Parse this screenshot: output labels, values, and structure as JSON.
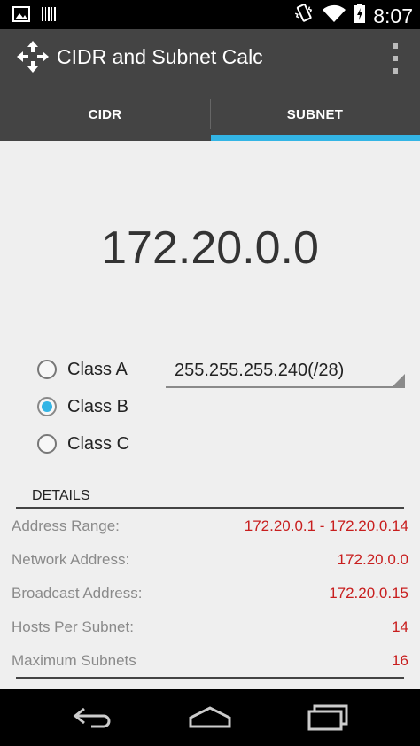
{
  "status_bar": {
    "time": "8:07",
    "icons": [
      "image-icon",
      "barcode-icon",
      "vibrate-icon",
      "wifi-icon",
      "battery-icon"
    ]
  },
  "action_bar": {
    "title": "CIDR and Subnet Calc",
    "app_icon": "move-arrows-icon",
    "overflow_icon": "overflow-menu-icon"
  },
  "tabs": [
    {
      "label": "CIDR",
      "selected": false
    },
    {
      "label": "SUBNET",
      "selected": true
    }
  ],
  "ip_address": "172.20.0.0",
  "ip_classes": [
    {
      "label": "Class A",
      "checked": false
    },
    {
      "label": "Class B",
      "checked": true
    },
    {
      "label": "Class C",
      "checked": false
    }
  ],
  "subnet_mask": {
    "selected": "255.255.255.240(/28)"
  },
  "details": {
    "header": "DETAILS",
    "rows": [
      {
        "label": "Address Range:",
        "value": "172.20.0.1 - 172.20.0.14"
      },
      {
        "label": "Network Address:",
        "value": "172.20.0.0"
      },
      {
        "label": "Broadcast Address:",
        "value": "172.20.0.15"
      },
      {
        "label": "Hosts Per Subnet:",
        "value": "14"
      },
      {
        "label": "Maximum Subnets",
        "value": "16"
      }
    ]
  },
  "colors": {
    "accent": "#33b5e5",
    "value_red": "#c81e1e",
    "action_bar": "#444444"
  },
  "nav_bar": {
    "icons": [
      "back-icon",
      "home-icon",
      "recents-icon"
    ]
  }
}
